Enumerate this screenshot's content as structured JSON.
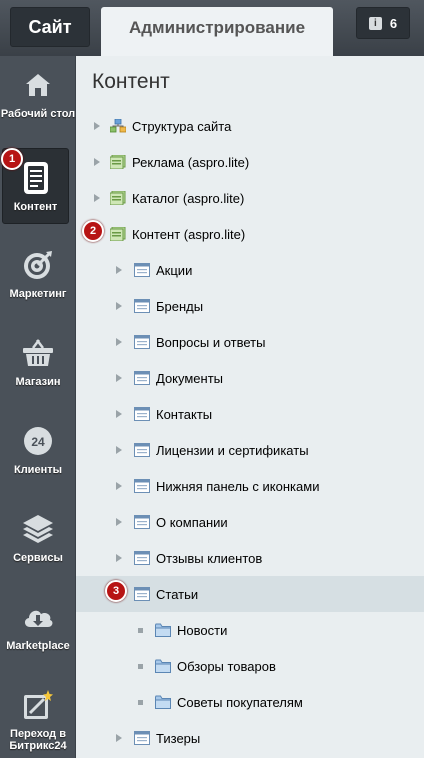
{
  "topbar": {
    "site_label": "Сайт",
    "admin_label": "Администрирование",
    "notifications_count": "6",
    "notifications_icon": "info-icon"
  },
  "sidebar": {
    "items": [
      {
        "label": "Рабочий стол",
        "icon": "home-icon"
      },
      {
        "label": "Контент",
        "icon": "document-icon",
        "active": true,
        "badge": "1"
      },
      {
        "label": "Маркетинг",
        "icon": "target-icon"
      },
      {
        "label": "Магазин",
        "icon": "basket-icon"
      },
      {
        "label": "Клиенты",
        "icon": "clock-24-icon"
      },
      {
        "label": "Сервисы",
        "icon": "layers-icon"
      },
      {
        "label": "Marketplace",
        "icon": "cloud-download-icon"
      },
      {
        "label": "Переход в Битрикс24",
        "icon": "magic-wand-icon"
      }
    ]
  },
  "main": {
    "title": "Контент",
    "tree": [
      {
        "label": "Структура сайта",
        "icon": "structure-icon",
        "level": 0
      },
      {
        "label": "Реклама (aspro.lite)",
        "icon": "iblock-type-icon",
        "level": 0
      },
      {
        "label": "Каталог (aspro.lite)",
        "icon": "iblock-type-icon",
        "level": 0
      },
      {
        "label": "Контент (aspro.lite)",
        "icon": "iblock-type-icon",
        "level": 0,
        "badge": "2",
        "expanded": true
      },
      {
        "label": "Акции",
        "icon": "iblock-icon",
        "level": 1
      },
      {
        "label": "Бренды",
        "icon": "iblock-icon",
        "level": 1
      },
      {
        "label": "Вопросы и ответы",
        "icon": "iblock-icon",
        "level": 1
      },
      {
        "label": "Документы",
        "icon": "iblock-icon",
        "level": 1
      },
      {
        "label": "Контакты",
        "icon": "iblock-icon",
        "level": 1
      },
      {
        "label": "Лицензии и сертификаты",
        "icon": "iblock-icon",
        "level": 1
      },
      {
        "label": "Нижняя панель с иконками",
        "icon": "iblock-icon",
        "level": 1
      },
      {
        "label": "О компании",
        "icon": "iblock-icon",
        "level": 1
      },
      {
        "label": "Отзывы клиентов",
        "icon": "iblock-icon",
        "level": 1
      },
      {
        "label": "Статьи",
        "icon": "iblock-icon",
        "level": 1,
        "badge": "3",
        "selected": true,
        "expanded": true
      },
      {
        "label": "Новости",
        "icon": "folder-icon",
        "level": 2
      },
      {
        "label": "Обзоры товаров",
        "icon": "folder-icon",
        "level": 2
      },
      {
        "label": "Советы покупателям",
        "icon": "folder-icon",
        "level": 2
      },
      {
        "label": "Тизеры",
        "icon": "iblock-icon",
        "level": 1
      }
    ]
  },
  "colors": {
    "sidebar_bg": "#4a5159",
    "badge_red": "#b71414",
    "content_bg": "#e9eef0",
    "selected_row": "#d6dfe3"
  }
}
